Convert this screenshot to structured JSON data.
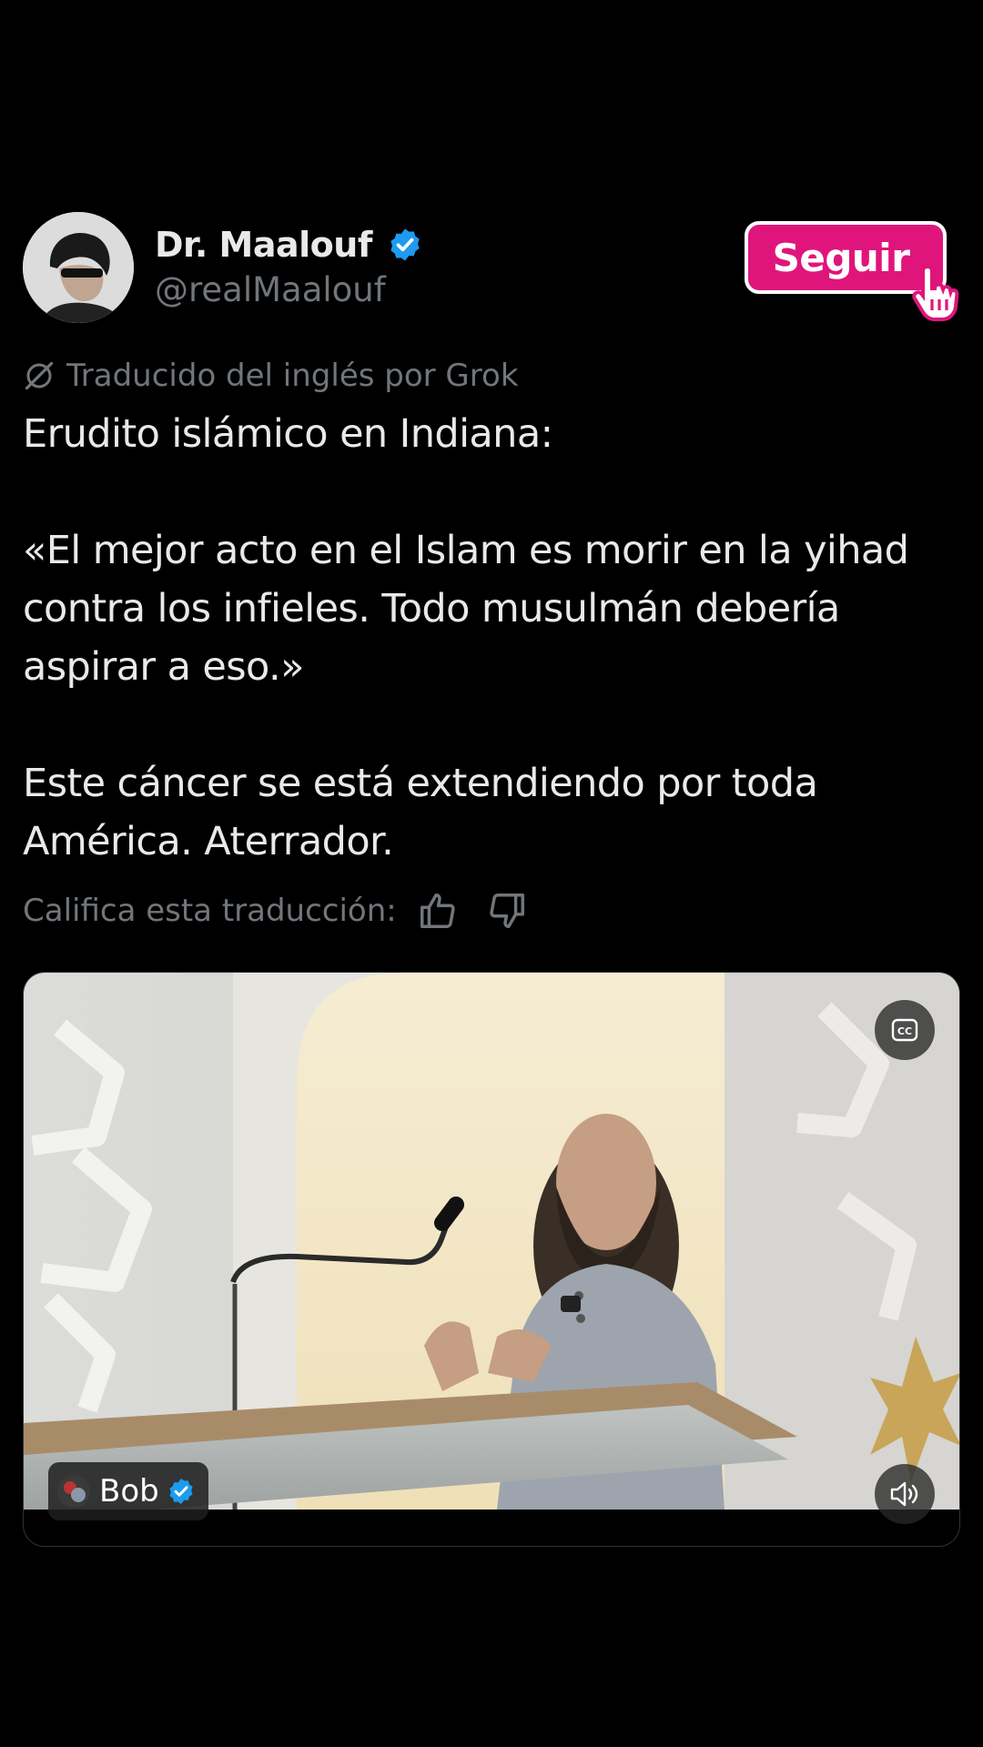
{
  "author": {
    "display_name": "Dr. Maalouf",
    "handle": "@realMaalouf",
    "verified": true,
    "avatar_icon": "profile-photo"
  },
  "follow_button": {
    "label": "Seguir",
    "color": "#e0157c"
  },
  "translation": {
    "note": "Traducido del inglés por Grok",
    "rate_label": "Califica esta traducción:"
  },
  "post": {
    "text": "Erudito islámico en Indiana:\n\n«El mejor acto en el Islam es morir en la yihad contra los infieles. Todo musulmán debería aspirar a eso.»\n\nEste cáncer se está extendiendo por toda América. Aterrador."
  },
  "media": {
    "attribution_name": "Bob",
    "attribution_verified": true,
    "cc_icon": "closed-captions-icon",
    "volume_icon": "volume-icon"
  },
  "colors": {
    "background": "#000000",
    "text": "#e7e9ea",
    "muted": "#71767b",
    "verified": "#1d9bf0"
  }
}
